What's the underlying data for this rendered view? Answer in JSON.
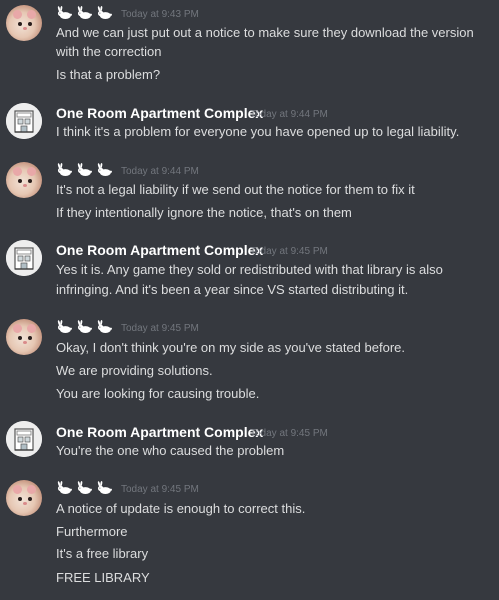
{
  "messages": [
    {
      "author": "🐇🐇🐇",
      "timestamp": "Today at 9:43 PM",
      "lines": [
        "And we can just put out a notice to make sure they download the version",
        "with the correction",
        "Is that a problem?"
      ]
    },
    {
      "author": "One Room Apartment Complex",
      "timestamp": "Today at 9:44 PM",
      "lines": [
        "I think it's a problem for everyone you have opened up to legal liability."
      ]
    },
    {
      "author": "🐇🐇🐇",
      "timestamp": "Today at 9:44 PM",
      "lines": [
        "It's not a legal liability if we send out the notice for them to fix it",
        "If they intentionally ignore the notice, that's on them"
      ]
    },
    {
      "author": "One Room Apartment Complex",
      "timestamp": "Today at 9:45 PM",
      "lines": [
        "Yes it is.  Any game they sold or redistributed with that library is also",
        "infringing.  And it's been a year since VS started distributing it."
      ]
    },
    {
      "author": "🐇🐇🐇",
      "timestamp": "Today at 9:45 PM",
      "lines": [
        "Okay, I don't think you're on my side as you've stated before.",
        "We are providing solutions.",
        "You are looking for causing trouble."
      ]
    },
    {
      "author": "One Room Apartment Complex",
      "timestamp": "Today at 9:45 PM",
      "lines": [
        "You're the one who caused the problem"
      ]
    },
    {
      "author": "🐇🐇🐇",
      "timestamp": "Today at 9:45 PM",
      "lines": [
        "A notice of update is enough to correct this.",
        "Furthermore",
        "It's a free library",
        "FREE LIBRARY"
      ]
    }
  ],
  "icons": {
    "hamster_avatar": "hamster-avatar-icon",
    "building_avatar": "building-avatar-icon",
    "bunny": "rabbit-icon"
  },
  "colors": {
    "background": "#36393f",
    "username": "#ffffff",
    "message_text": "#dcddde",
    "timestamp": "#72767d"
  }
}
